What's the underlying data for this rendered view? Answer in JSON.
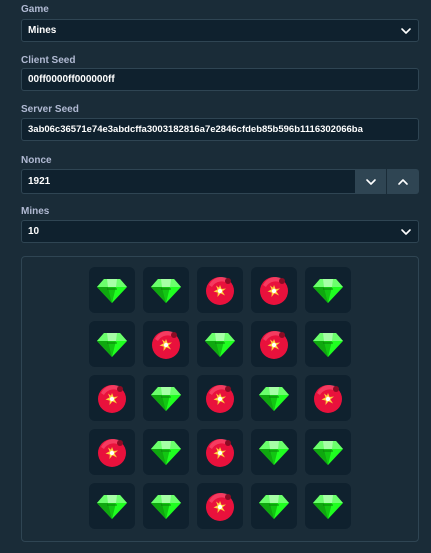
{
  "game": {
    "label": "Game",
    "value": "Mines"
  },
  "client_seed": {
    "label": "Client Seed",
    "value": "00ff0000ff000000ff"
  },
  "server_seed": {
    "label": "Server Seed",
    "value": "3ab06c36571e74e3abdcffa3003182816a7e2846cfdeb85b596b1116302066ba"
  },
  "nonce": {
    "label": "Nonce",
    "value": "1921"
  },
  "mines": {
    "label": "Mines",
    "value": "10"
  },
  "icons": {
    "gem": "gem-icon",
    "mine": "mine-icon",
    "chevron": "chevron-down-icon"
  },
  "colors": {
    "background": "#1a2c38",
    "input_bg": "#0f212e",
    "border": "#2f4553",
    "label": "#b1bad3",
    "gem": "#1fff20",
    "mine": "#e9113c"
  },
  "board": {
    "rows": [
      [
        "gem",
        "gem",
        "mine",
        "mine",
        "gem"
      ],
      [
        "gem",
        "mine",
        "gem",
        "mine",
        "gem"
      ],
      [
        "mine",
        "gem",
        "mine",
        "gem",
        "mine"
      ],
      [
        "mine",
        "gem",
        "mine",
        "gem",
        "gem"
      ],
      [
        "gem",
        "gem",
        "mine",
        "gem",
        "gem"
      ]
    ]
  }
}
